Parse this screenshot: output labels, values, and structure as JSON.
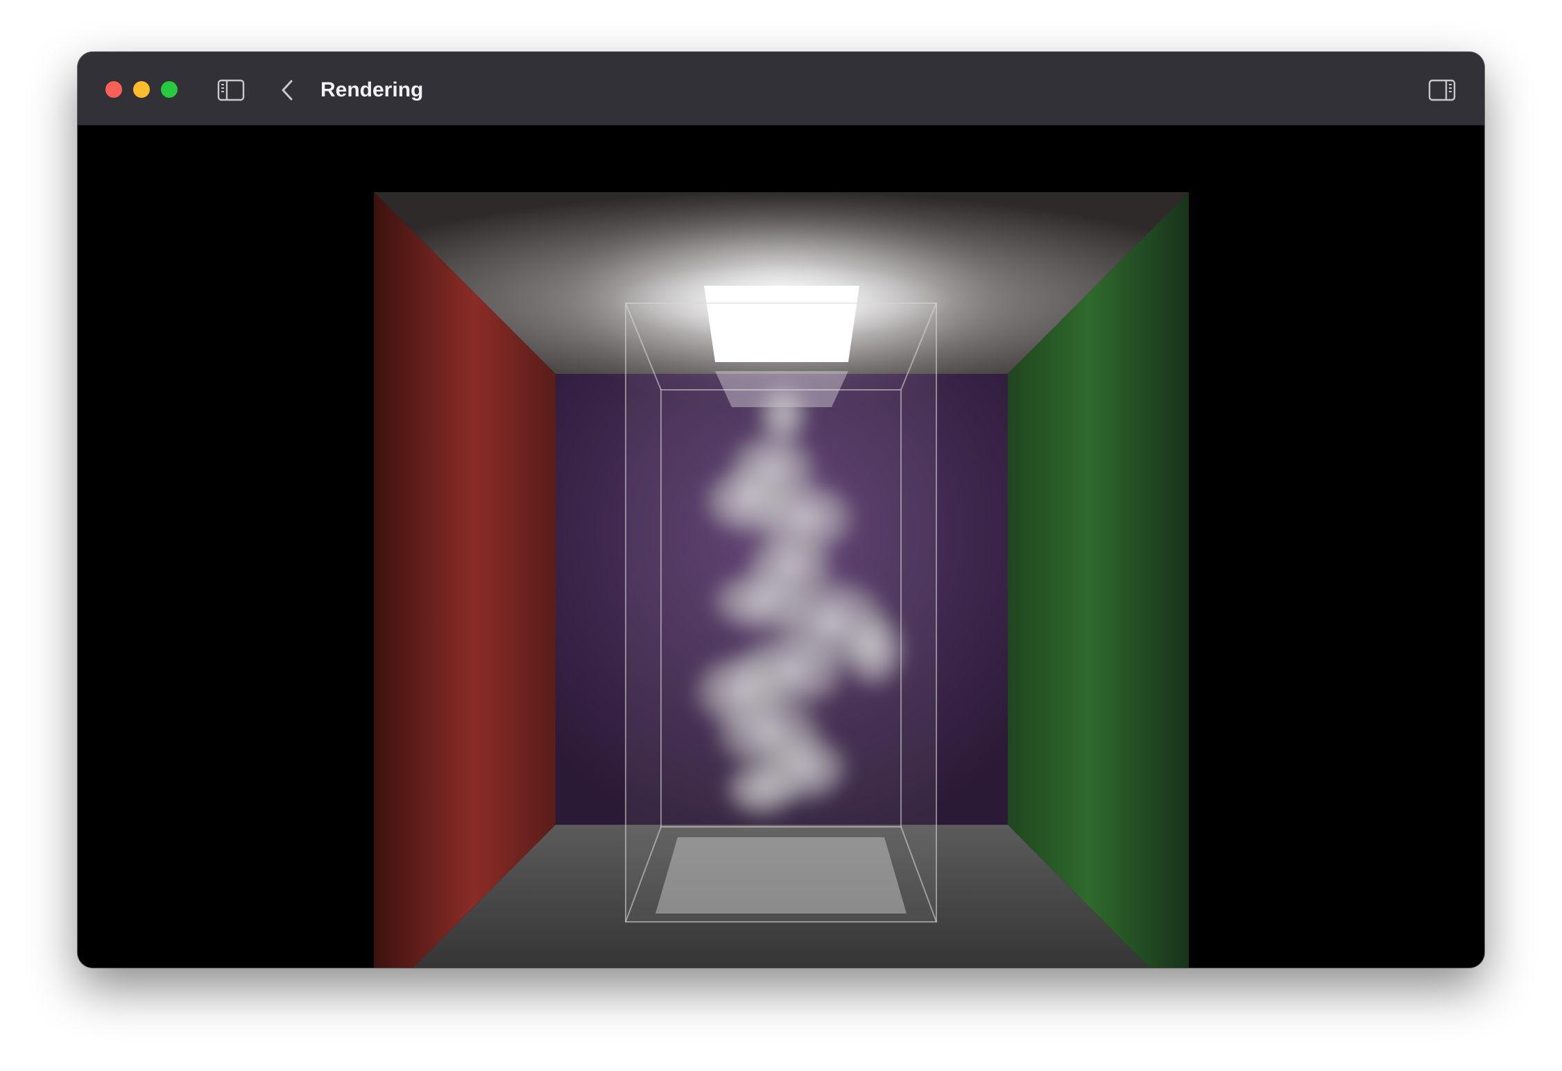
{
  "window": {
    "title": "Rendering",
    "traffic_lights": {
      "close_color": "#fe5f57",
      "minimize_color": "#febc2e",
      "zoom_color": "#28c840"
    },
    "toolbar": {
      "sidebar_toggle_icon": "sidebar-left-icon",
      "back_icon": "chevron-left-icon",
      "inspector_toggle_icon": "sidebar-right-icon"
    }
  },
  "render": {
    "scene": "cornell-box-smoke",
    "colors": {
      "left_wall": "#8a2c27",
      "right_wall": "#2f6a2c",
      "back_wall": "#4a2f5a",
      "floor": "#4a4a4a",
      "ceiling": "#555050",
      "smoke": "#d8d8d8",
      "light": "#ffffff"
    }
  }
}
